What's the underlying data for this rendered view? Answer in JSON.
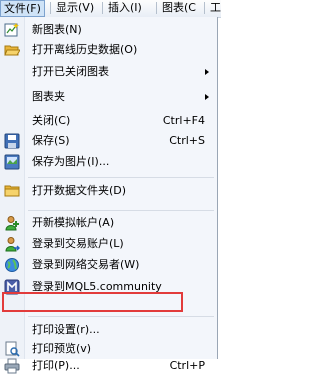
{
  "menubar": {
    "items": [
      {
        "label": "文件(F)"
      },
      {
        "label": "显示(V)"
      },
      {
        "label": "插入(I)"
      },
      {
        "label": "图表(C"
      },
      {
        "label": "工"
      }
    ]
  },
  "menu": {
    "new_chart": "新图表(N)",
    "open_offline": "打开离线历史数据(O)",
    "open_closed": "打开已关闭图表",
    "chart_folder": "图表夹",
    "close": "关闭(C)",
    "close_shortcut": "Ctrl+F4",
    "save": "保存(S)",
    "save_shortcut": "Ctrl+S",
    "save_as_image": "保存为图片(I)...",
    "open_data_folder": "打开数据文件夹(D)",
    "open_demo_account": "开新模拟帐户(A)",
    "login_trade_account": "登录到交易账户(L)",
    "login_web_trader": "登录到网络交易者(W)",
    "login_mql5": "登录到MQL5.community",
    "print_setup": "打印设置(r)...",
    "print_preview": "打印预览(v)",
    "print": "打印(P)...",
    "print_shortcut": "Ctrl+P"
  },
  "colors": {
    "highlight_border": "#e23b3b",
    "menu_bg": "#f3f6fb"
  }
}
